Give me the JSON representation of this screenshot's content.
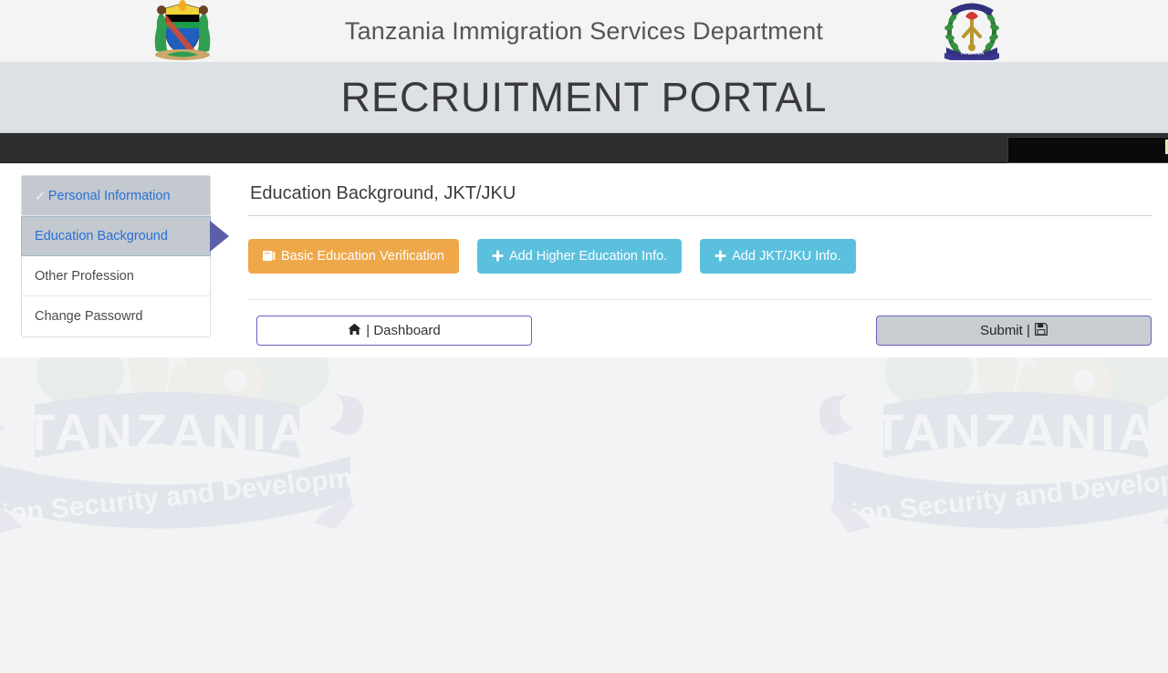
{
  "header": {
    "brand_title": "Tanzania Immigration Services Department",
    "portal_title": "RECRUITMENT PORTAL",
    "emblem_left_name": "tanzania-coat-of-arms",
    "emblem_right_name": "immigration-department-badge"
  },
  "sidebar": {
    "items": [
      {
        "label": "Personal Information",
        "state": "done",
        "check": "✓"
      },
      {
        "label": "Education Background",
        "state": "active",
        "check": ""
      },
      {
        "label": "Other Profession",
        "state": "normal",
        "check": ""
      },
      {
        "label": "Change Passowrd",
        "state": "normal",
        "check": ""
      }
    ]
  },
  "main": {
    "page_heading": "Education Background, JKT/JKU",
    "buttons": [
      {
        "label": "Basic Education Verification",
        "icon": "book-icon",
        "glyph": "📖",
        "color": "#eea849"
      },
      {
        "label": "Add Higher Education Info.",
        "icon": "plus-icon",
        "glyph": "✚",
        "color": "#5bc0de"
      },
      {
        "label": "Add JKT/JKU Info.",
        "icon": "plus-icon",
        "glyph": "✚",
        "color": "#5bc0de"
      }
    ],
    "dashboard_button": {
      "label": "| Dashboard",
      "icon": "home-icon",
      "glyph": "🏠"
    },
    "submit_button": {
      "label": "Submit |",
      "icon": "save-icon",
      "glyph": "💾"
    }
  },
  "watermark": {
    "banner_text": "TANZANIA",
    "ribbon_text": "Migration Security and Development"
  },
  "colors": {
    "accent_orange": "#eea849",
    "accent_blue": "#5bc0de",
    "link_blue": "#2a6ed8",
    "navbar_dark": "#2e2e2e",
    "band_gray": "#dde1e6",
    "purple_border": "#6a5fc0",
    "page_bg": "#f2f3f4"
  }
}
